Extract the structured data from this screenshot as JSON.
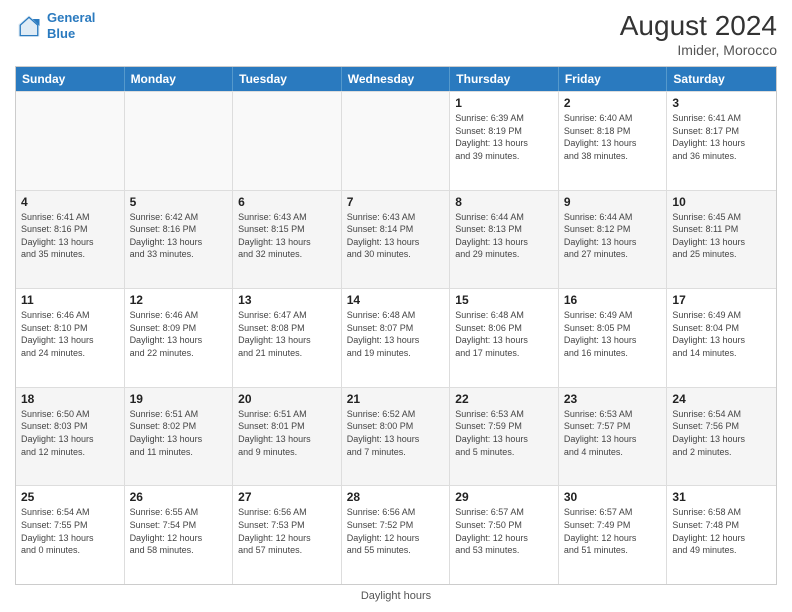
{
  "header": {
    "logo_line1": "General",
    "logo_line2": "Blue",
    "month_year": "August 2024",
    "location": "Imider, Morocco"
  },
  "footer": {
    "label": "Daylight hours"
  },
  "days_of_week": [
    "Sunday",
    "Monday",
    "Tuesday",
    "Wednesday",
    "Thursday",
    "Friday",
    "Saturday"
  ],
  "weeks": [
    [
      {
        "day": "",
        "info": ""
      },
      {
        "day": "",
        "info": ""
      },
      {
        "day": "",
        "info": ""
      },
      {
        "day": "",
        "info": ""
      },
      {
        "day": "1",
        "info": "Sunrise: 6:39 AM\nSunset: 8:19 PM\nDaylight: 13 hours\nand 39 minutes."
      },
      {
        "day": "2",
        "info": "Sunrise: 6:40 AM\nSunset: 8:18 PM\nDaylight: 13 hours\nand 38 minutes."
      },
      {
        "day": "3",
        "info": "Sunrise: 6:41 AM\nSunset: 8:17 PM\nDaylight: 13 hours\nand 36 minutes."
      }
    ],
    [
      {
        "day": "4",
        "info": "Sunrise: 6:41 AM\nSunset: 8:16 PM\nDaylight: 13 hours\nand 35 minutes."
      },
      {
        "day": "5",
        "info": "Sunrise: 6:42 AM\nSunset: 8:16 PM\nDaylight: 13 hours\nand 33 minutes."
      },
      {
        "day": "6",
        "info": "Sunrise: 6:43 AM\nSunset: 8:15 PM\nDaylight: 13 hours\nand 32 minutes."
      },
      {
        "day": "7",
        "info": "Sunrise: 6:43 AM\nSunset: 8:14 PM\nDaylight: 13 hours\nand 30 minutes."
      },
      {
        "day": "8",
        "info": "Sunrise: 6:44 AM\nSunset: 8:13 PM\nDaylight: 13 hours\nand 29 minutes."
      },
      {
        "day": "9",
        "info": "Sunrise: 6:44 AM\nSunset: 8:12 PM\nDaylight: 13 hours\nand 27 minutes."
      },
      {
        "day": "10",
        "info": "Sunrise: 6:45 AM\nSunset: 8:11 PM\nDaylight: 13 hours\nand 25 minutes."
      }
    ],
    [
      {
        "day": "11",
        "info": "Sunrise: 6:46 AM\nSunset: 8:10 PM\nDaylight: 13 hours\nand 24 minutes."
      },
      {
        "day": "12",
        "info": "Sunrise: 6:46 AM\nSunset: 8:09 PM\nDaylight: 13 hours\nand 22 minutes."
      },
      {
        "day": "13",
        "info": "Sunrise: 6:47 AM\nSunset: 8:08 PM\nDaylight: 13 hours\nand 21 minutes."
      },
      {
        "day": "14",
        "info": "Sunrise: 6:48 AM\nSunset: 8:07 PM\nDaylight: 13 hours\nand 19 minutes."
      },
      {
        "day": "15",
        "info": "Sunrise: 6:48 AM\nSunset: 8:06 PM\nDaylight: 13 hours\nand 17 minutes."
      },
      {
        "day": "16",
        "info": "Sunrise: 6:49 AM\nSunset: 8:05 PM\nDaylight: 13 hours\nand 16 minutes."
      },
      {
        "day": "17",
        "info": "Sunrise: 6:49 AM\nSunset: 8:04 PM\nDaylight: 13 hours\nand 14 minutes."
      }
    ],
    [
      {
        "day": "18",
        "info": "Sunrise: 6:50 AM\nSunset: 8:03 PM\nDaylight: 13 hours\nand 12 minutes."
      },
      {
        "day": "19",
        "info": "Sunrise: 6:51 AM\nSunset: 8:02 PM\nDaylight: 13 hours\nand 11 minutes."
      },
      {
        "day": "20",
        "info": "Sunrise: 6:51 AM\nSunset: 8:01 PM\nDaylight: 13 hours\nand 9 minutes."
      },
      {
        "day": "21",
        "info": "Sunrise: 6:52 AM\nSunset: 8:00 PM\nDaylight: 13 hours\nand 7 minutes."
      },
      {
        "day": "22",
        "info": "Sunrise: 6:53 AM\nSunset: 7:59 PM\nDaylight: 13 hours\nand 5 minutes."
      },
      {
        "day": "23",
        "info": "Sunrise: 6:53 AM\nSunset: 7:57 PM\nDaylight: 13 hours\nand 4 minutes."
      },
      {
        "day": "24",
        "info": "Sunrise: 6:54 AM\nSunset: 7:56 PM\nDaylight: 13 hours\nand 2 minutes."
      }
    ],
    [
      {
        "day": "25",
        "info": "Sunrise: 6:54 AM\nSunset: 7:55 PM\nDaylight: 13 hours\nand 0 minutes."
      },
      {
        "day": "26",
        "info": "Sunrise: 6:55 AM\nSunset: 7:54 PM\nDaylight: 12 hours\nand 58 minutes."
      },
      {
        "day": "27",
        "info": "Sunrise: 6:56 AM\nSunset: 7:53 PM\nDaylight: 12 hours\nand 57 minutes."
      },
      {
        "day": "28",
        "info": "Sunrise: 6:56 AM\nSunset: 7:52 PM\nDaylight: 12 hours\nand 55 minutes."
      },
      {
        "day": "29",
        "info": "Sunrise: 6:57 AM\nSunset: 7:50 PM\nDaylight: 12 hours\nand 53 minutes."
      },
      {
        "day": "30",
        "info": "Sunrise: 6:57 AM\nSunset: 7:49 PM\nDaylight: 12 hours\nand 51 minutes."
      },
      {
        "day": "31",
        "info": "Sunrise: 6:58 AM\nSunset: 7:48 PM\nDaylight: 12 hours\nand 49 minutes."
      }
    ]
  ]
}
